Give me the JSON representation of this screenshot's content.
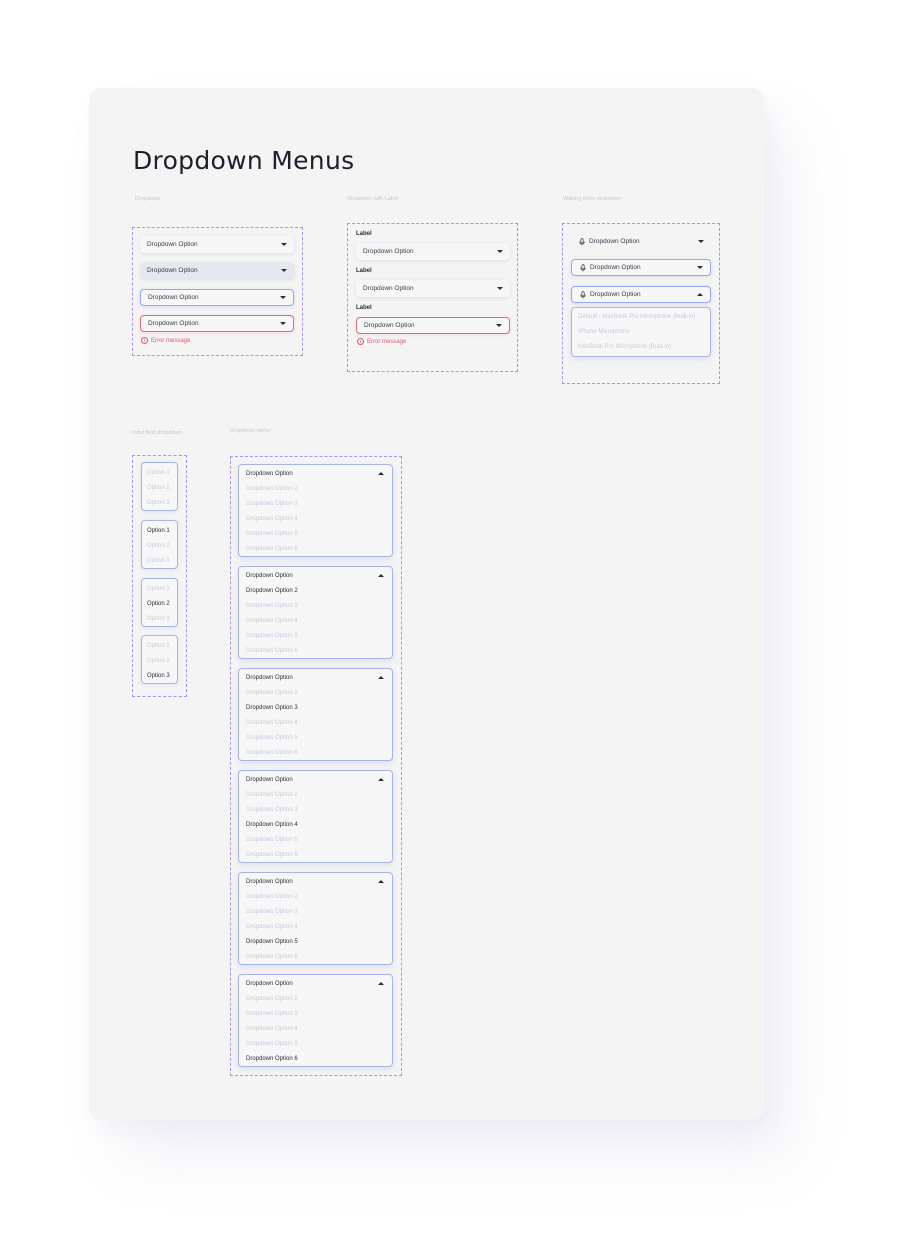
{
  "page": {
    "title": "Dropdown Menus"
  },
  "sections": {
    "dropdown": "Dropdown",
    "dropdown_with_label": "Dropdown with Label",
    "waiting_room": "Waiting room dropdown",
    "input_field": "Input field dropdown",
    "dropdown_menu": "Dropdown menu"
  },
  "dropdown": {
    "option": "Dropdown Option",
    "error": "Error message"
  },
  "labeled": {
    "label": "Label",
    "option": "Dropdown Option",
    "error": "Error message"
  },
  "waiting": {
    "option": "Dropdown Option",
    "items": [
      "Default - MacBook Pro Microphone (Built-in)",
      "iPhone Microphone",
      "MacBook Pro Microphone (Built-in)"
    ]
  },
  "input_field": {
    "options": [
      "Option 1",
      "Option 2",
      "Option 3"
    ],
    "selected": [
      null,
      0,
      1,
      2
    ]
  },
  "menu": {
    "head": "Dropdown Option",
    "items": [
      "Dropdown Option 2",
      "Dropdown Option 3",
      "Dropdown Option 4",
      "Dropdown Option 5",
      "Dropdown Option 6"
    ],
    "selected": [
      null,
      0,
      1,
      2,
      3,
      4
    ]
  },
  "colors": {
    "accent_dash": "#a892f4",
    "focus_border": "#9aa8e6",
    "error": "#e0566a",
    "muted": "#c6c9db"
  },
  "icons": {
    "caret": "caret-down-icon",
    "caret_open": "caret-up-icon",
    "mic": "microphone-icon",
    "error": "error-circle-icon"
  }
}
